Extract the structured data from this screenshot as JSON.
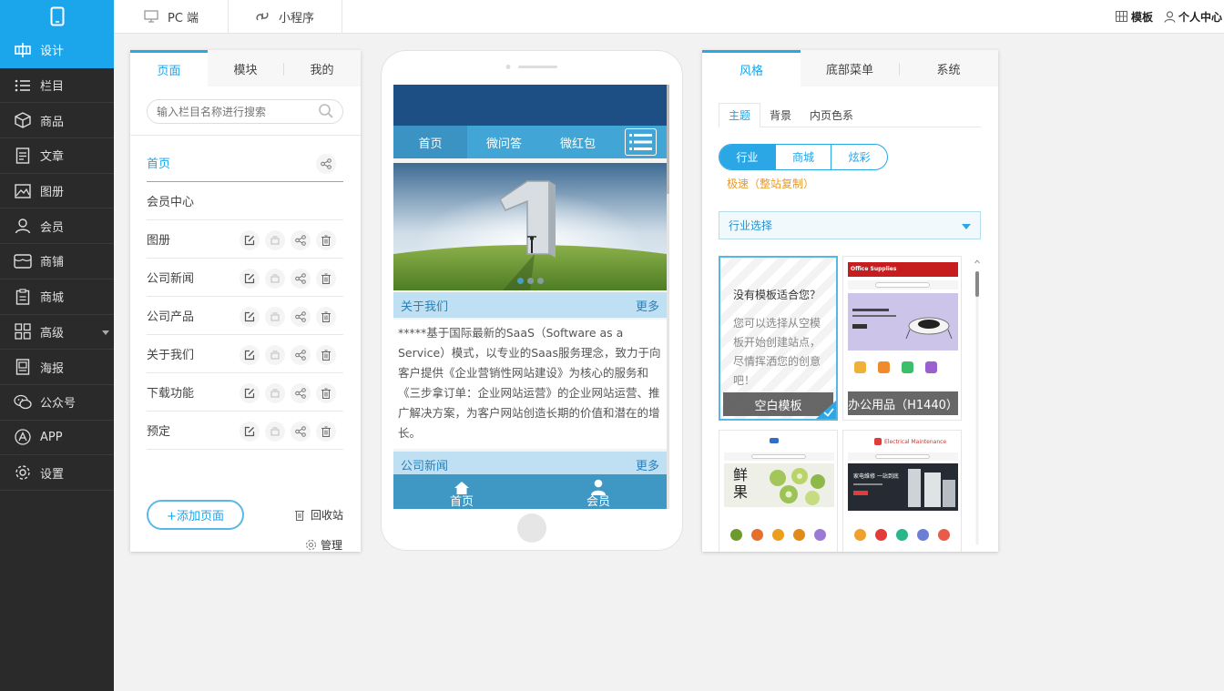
{
  "topbar": {
    "tabs": [
      {
        "label": "PC 端",
        "icon": "monitor-icon"
      },
      {
        "label": "小程序",
        "icon": "mini-program-icon"
      }
    ],
    "template_label": "模板",
    "user_center_label": "个人中心"
  },
  "sidebar": {
    "items": [
      {
        "label": "设计",
        "icon": "design-icon",
        "active": true
      },
      {
        "label": "栏目",
        "icon": "list-icon"
      },
      {
        "label": "商品",
        "icon": "box-icon"
      },
      {
        "label": "文章",
        "icon": "article-icon"
      },
      {
        "label": "图册",
        "icon": "image-icon"
      },
      {
        "label": "会员",
        "icon": "user-icon"
      },
      {
        "label": "商铺",
        "icon": "store-icon"
      },
      {
        "label": "商城",
        "icon": "clipboard-icon"
      },
      {
        "label": "高级",
        "icon": "grid-icon"
      },
      {
        "label": "海报",
        "icon": "poster-icon"
      },
      {
        "label": "公众号",
        "icon": "wechat-icon"
      },
      {
        "label": "APP",
        "icon": "app-icon"
      },
      {
        "label": "设置",
        "icon": "gear-icon"
      }
    ]
  },
  "left_panel": {
    "tabs": [
      "页面",
      "模块",
      "我的"
    ],
    "search_placeholder": "输入栏目名称进行搜索",
    "pages": [
      "首页",
      "会员中心",
      "图册",
      "公司新闻",
      "公司产品",
      "关于我们",
      "下载功能",
      "预定"
    ],
    "add_page_label": "+添加页面",
    "recycle_label": "回收站",
    "manage_label": "管理"
  },
  "phone": {
    "nav": [
      "首页",
      "微问答",
      "微红包"
    ],
    "section1": {
      "title": "关于我们",
      "more": "更多"
    },
    "body_text": "*****基于国际最新的SaaS（Software as a Service）模式，以专业的Saas服务理念，致力于向客户提供《企业营销性网站建设》为核心的服务和《三步拿订单：企业网站运营》的企业网站运营、推广解决方案，为客户网站创造长期的价值和潜在的增长。",
    "section2": {
      "title": "公司新闻",
      "more": "更多"
    },
    "bottom_tabs": [
      "首页",
      "会员"
    ]
  },
  "right_panel": {
    "tabs": [
      "风格",
      "底部菜单",
      "系统"
    ],
    "subtabs": [
      "主题",
      "背景",
      "内页色系"
    ],
    "segments": [
      "行业",
      "商城",
      "炫彩"
    ],
    "note": "极速（整站复制）",
    "industry_select": "行业选择",
    "blank_template": {
      "title": "没有模板适合您？",
      "desc": "您可以选择从空模板开始创建站点，尽情挥洒您的创意吧！",
      "caption": "空白模板"
    },
    "office_template": {
      "caption": "办公用品（H1440）",
      "header": "Office Supplies"
    },
    "fruit_template": {
      "text": "鲜果"
    },
    "repair_template": {
      "header": "Electrical Maintenance",
      "banner": "家电维修 一站到底"
    }
  }
}
